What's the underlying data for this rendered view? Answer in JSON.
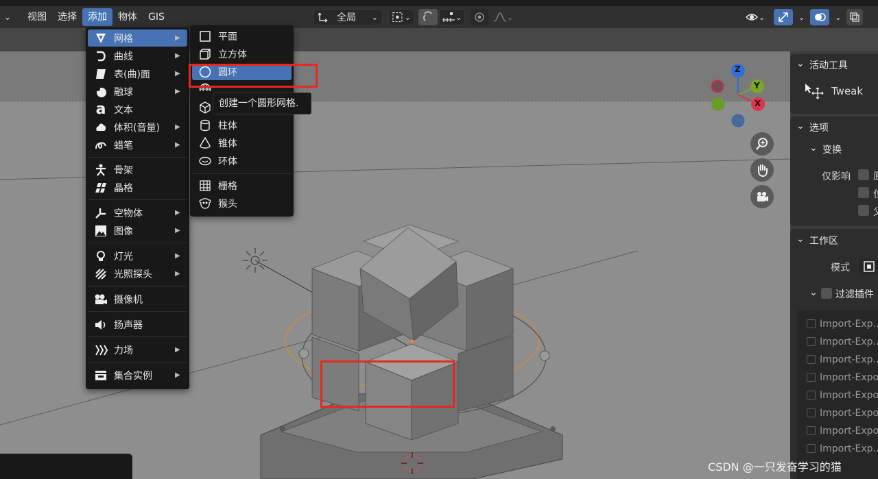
{
  "menubar": {
    "items": [
      "视图",
      "选择",
      "添加",
      "物体",
      "GIS"
    ],
    "active": "添加"
  },
  "header_controls": {
    "transform_orientation": "全局"
  },
  "add_menu": {
    "items": [
      {
        "label": "网格",
        "icon": "mesh-icon",
        "submenu": true
      },
      {
        "label": "曲线",
        "icon": "curve-icon",
        "submenu": true
      },
      {
        "label": "表(曲)面",
        "icon": "surface-icon",
        "submenu": true
      },
      {
        "label": "融球",
        "icon": "metaball-icon",
        "submenu": true
      },
      {
        "label": "文本",
        "icon": "text-icon",
        "submenu": false
      },
      {
        "label": "体积(音量)",
        "icon": "volume-icon",
        "submenu": true
      },
      {
        "label": "蜡笔",
        "icon": "grease-pencil-icon",
        "submenu": true
      },
      {
        "label": "骨架",
        "icon": "armature-icon",
        "submenu": false
      },
      {
        "label": "晶格",
        "icon": "lattice-icon",
        "submenu": false
      },
      {
        "label": "空物体",
        "icon": "empty-icon",
        "submenu": true
      },
      {
        "label": "图像",
        "icon": "image-icon",
        "submenu": true
      },
      {
        "label": "灯光",
        "icon": "light-icon",
        "submenu": true
      },
      {
        "label": "光照探头",
        "icon": "light-probe-icon",
        "submenu": true
      },
      {
        "label": "摄像机",
        "icon": "camera-icon",
        "submenu": false
      },
      {
        "label": "扬声器",
        "icon": "speaker-icon",
        "submenu": false
      },
      {
        "label": "力场",
        "icon": "force-field-icon",
        "submenu": true
      },
      {
        "label": "集合实例",
        "icon": "collection-instance-icon",
        "submenu": true
      }
    ]
  },
  "mesh_menu": {
    "items": [
      {
        "label": "平面",
        "icon": "plane-icon"
      },
      {
        "label": "立方体",
        "icon": "cube-icon"
      },
      {
        "label": "圆环",
        "icon": "circle-icon"
      },
      {
        "label": "",
        "icon": "uv-sphere-icon"
      },
      {
        "label": "",
        "icon": "ico-sphere-icon"
      },
      {
        "label": "柱体",
        "icon": "cylinder-icon"
      },
      {
        "label": "锥体",
        "icon": "cone-icon"
      },
      {
        "label": "环体",
        "icon": "torus-icon"
      },
      {
        "label": "栅格",
        "icon": "grid-icon"
      },
      {
        "label": "猴头",
        "icon": "monkey-icon"
      }
    ],
    "tooltip": "创建一个圆形网格."
  },
  "gizmo": {
    "z": "Z",
    "y": "Y",
    "x": "X"
  },
  "right_panel": {
    "active_tool_title": "活动工具",
    "tool_name": "Tweak",
    "options_title": "选项",
    "transform_title": "变换",
    "affect_only": "仅影响",
    "affect_items": [
      "原",
      "位",
      "父"
    ],
    "workspace_title": "工作区",
    "mode_label": "模式",
    "filter_addons": "过滤插件",
    "plugins": [
      "Import-Exp...",
      "Import-Exp...",
      "Import-Exp...",
      "Import-Expo",
      "Import-Expo",
      "Import-Expo",
      "Import-Expo",
      "Import-Exp..."
    ]
  },
  "watermark": "CSDN @一只发奋学习的猫"
}
